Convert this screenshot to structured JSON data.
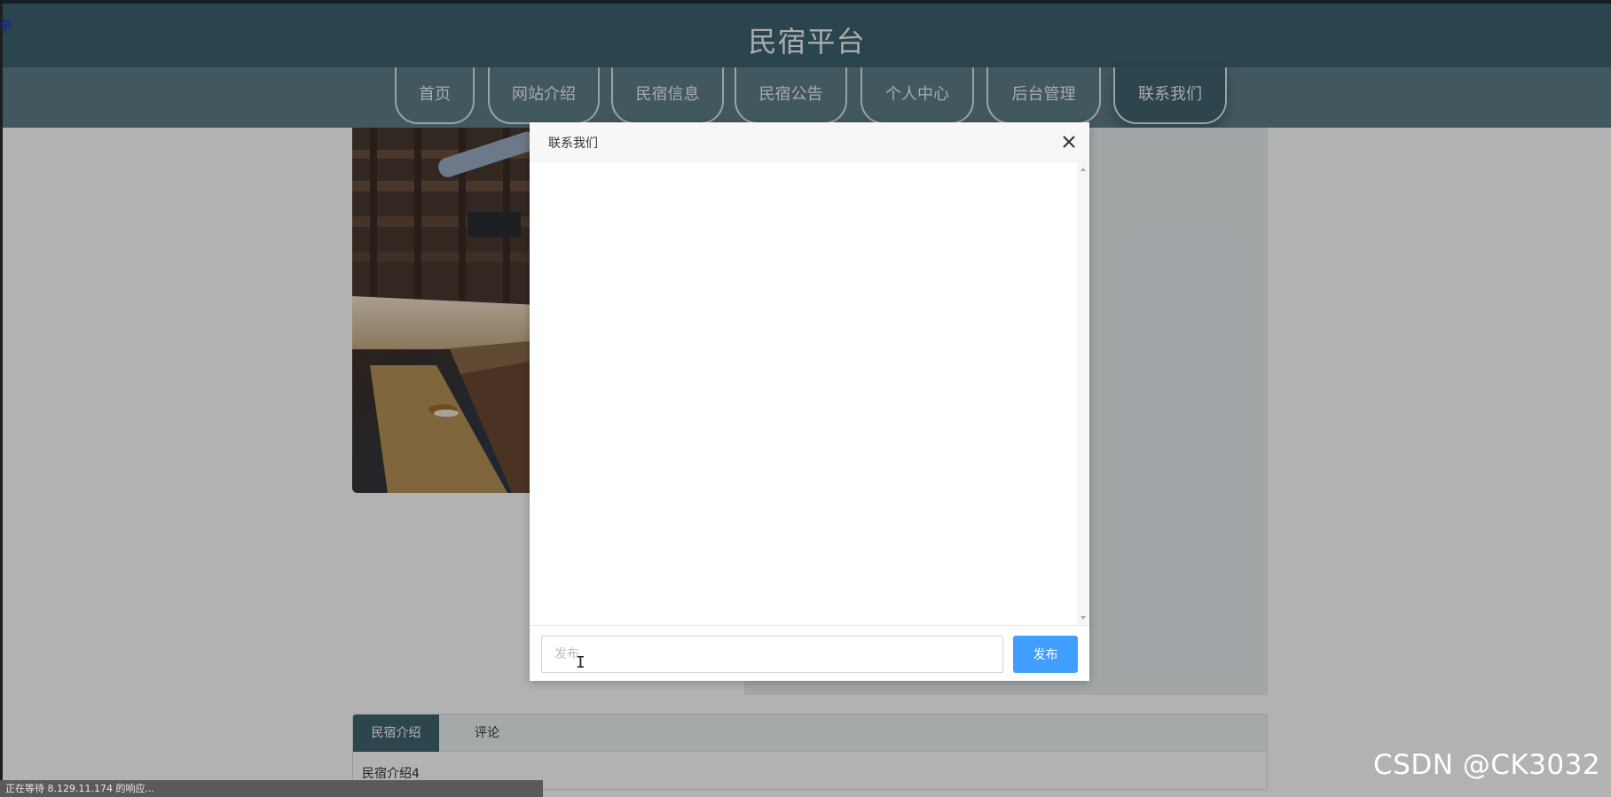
{
  "header": {
    "title": "民宿平台"
  },
  "corner_glyph": "亭",
  "nav": {
    "items": [
      {
        "label": "首页",
        "active": false
      },
      {
        "label": "网站介绍",
        "active": false
      },
      {
        "label": "民宿信息",
        "active": false
      },
      {
        "label": "民宿公告",
        "active": false
      },
      {
        "label": "个人中心",
        "active": false
      },
      {
        "label": "后台管理",
        "active": false
      },
      {
        "label": "联系我们",
        "active": true
      }
    ]
  },
  "detail": {
    "tabs": [
      {
        "label": "民宿介绍",
        "active": true
      },
      {
        "label": "评论",
        "active": false
      }
    ],
    "content": "民宿介绍4"
  },
  "modal": {
    "title": "联系我们",
    "input_placeholder": "发布",
    "submit_label": "发布"
  },
  "status_bar": {
    "text": "正在等待 8.129.11.174 的响应..."
  },
  "watermark": "CSDN @CK3032",
  "colors": {
    "header_bg": "#3e6370",
    "nav_bg": "#5f7f89",
    "accent": "#41636e",
    "primary_button": "#409eff"
  }
}
